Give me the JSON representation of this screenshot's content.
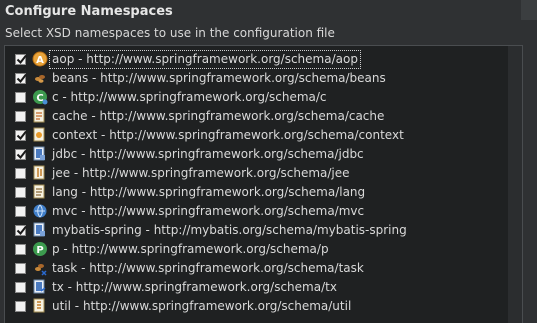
{
  "dialog": {
    "title": "Configure Namespaces",
    "subtitle": "Select XSD namespaces to use in the configuration file"
  },
  "namespaces": [
    {
      "label": "aop - http://www.springframework.org/schema/aop",
      "checked": true,
      "icon": "aop-icon",
      "selected": true
    },
    {
      "label": "beans - http://www.springframework.org/schema/beans",
      "checked": true,
      "icon": "beans-icon"
    },
    {
      "label": "c - http://www.springframework.org/schema/c",
      "checked": false,
      "icon": "c-namespace-icon"
    },
    {
      "label": "cache - http://www.springframework.org/schema/cache",
      "checked": false,
      "icon": "cache-icon"
    },
    {
      "label": "context - http://www.springframework.org/schema/context",
      "checked": true,
      "icon": "context-icon"
    },
    {
      "label": "jdbc - http://www.springframework.org/schema/jdbc",
      "checked": true,
      "icon": "jdbc-icon"
    },
    {
      "label": "jee - http://www.springframework.org/schema/jee",
      "checked": false,
      "icon": "jee-icon"
    },
    {
      "label": "lang - http://www.springframework.org/schema/lang",
      "checked": false,
      "icon": "lang-icon"
    },
    {
      "label": "mvc - http://www.springframework.org/schema/mvc",
      "checked": false,
      "icon": "mvc-icon"
    },
    {
      "label": "mybatis-spring - http://mybatis.org/schema/mybatis-spring",
      "checked": true,
      "icon": "mybatis-spring-icon"
    },
    {
      "label": "p - http://www.springframework.org/schema/p",
      "checked": false,
      "icon": "p-namespace-icon"
    },
    {
      "label": "task - http://www.springframework.org/schema/task",
      "checked": false,
      "icon": "task-icon"
    },
    {
      "label": "tx - http://www.springframework.org/schema/tx",
      "checked": false,
      "icon": "tx-icon"
    },
    {
      "label": "util - http://www.springframework.org/schema/util",
      "checked": false,
      "icon": "util-icon"
    }
  ]
}
